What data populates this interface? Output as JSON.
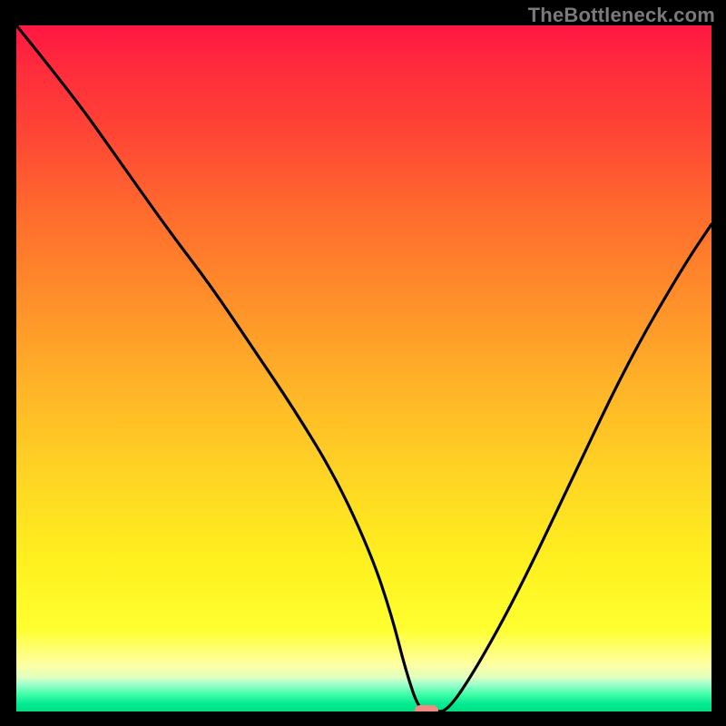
{
  "watermark": "TheBottleneck.com",
  "chart_data": {
    "type": "line",
    "title": "",
    "xlabel": "",
    "ylabel": "",
    "xlim": [
      0,
      100
    ],
    "ylim": [
      0,
      100
    ],
    "series": [
      {
        "name": "bottleneck-curve",
        "x": [
          0,
          8,
          15,
          22,
          28,
          34,
          40,
          46,
          51,
          54,
          56,
          58,
          60,
          62,
          66,
          72,
          80,
          88,
          96,
          100
        ],
        "values": [
          100,
          90,
          80,
          70,
          62,
          53,
          44,
          34,
          23,
          14,
          6,
          0,
          0,
          0,
          6,
          17,
          34,
          51,
          65,
          71
        ]
      }
    ],
    "marker": {
      "x": 59,
      "y": 0,
      "color": "#f38a82"
    },
    "gradient_stops": [
      {
        "pos": 0,
        "color": "#ff1744"
      },
      {
        "pos": 15,
        "color": "#ff4336"
      },
      {
        "pos": 40,
        "color": "#ff8f2a"
      },
      {
        "pos": 65,
        "color": "#ffd324"
      },
      {
        "pos": 88,
        "color": "#ffff30"
      },
      {
        "pos": 97,
        "color": "#40ffa8"
      },
      {
        "pos": 100,
        "color": "#00e080"
      }
    ]
  },
  "colors": {
    "background": "#000000",
    "curve": "#000000",
    "marker": "#f38a82"
  }
}
